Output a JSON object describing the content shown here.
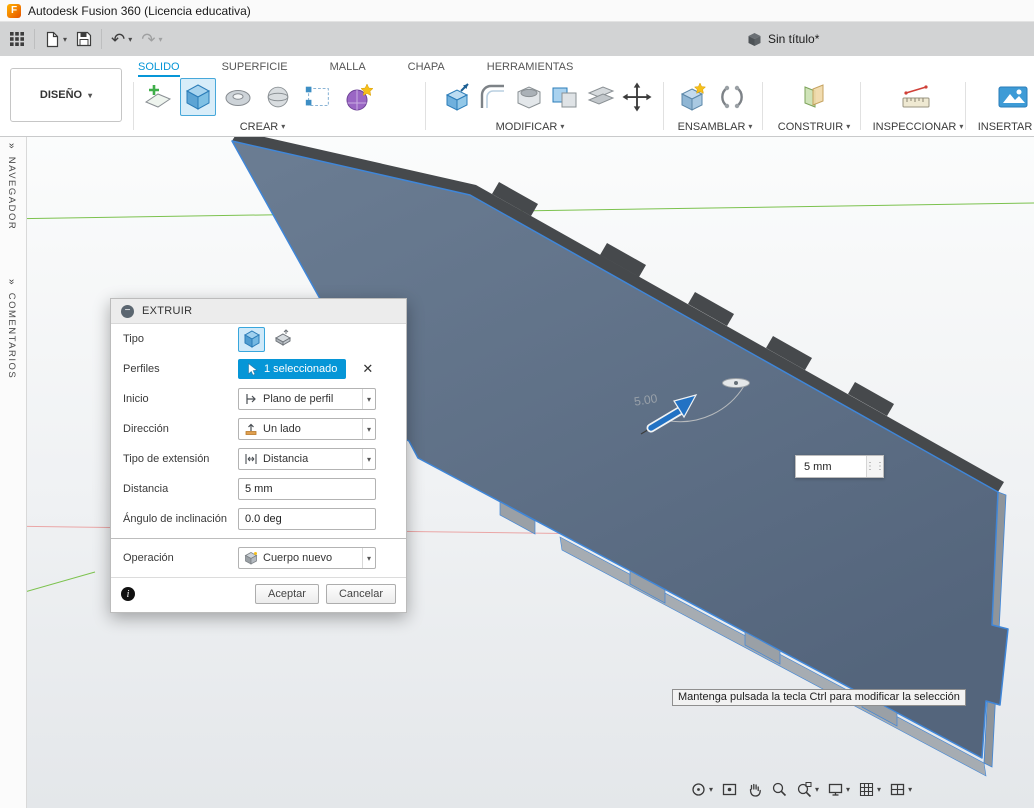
{
  "colors": {
    "accent_blue": "#0696d7",
    "selection_blue": "#3f86d8",
    "plate_face": "#5d7187",
    "axis_green": "#7cc24e",
    "axis_red": "#eaa6a6"
  },
  "icons": {
    "caret_down": "▾",
    "undo": "↶",
    "redo": "↷",
    "close": "✕",
    "info": "i",
    "expand_chevrons": "»",
    "grip_dots": "⋮⋮",
    "minus": "−"
  },
  "titlebar": {
    "app_title": "Autodesk Fusion 360 (Licencia educativa)",
    "logo_letter": "F"
  },
  "quickbar": {
    "document_title": "Sin título*"
  },
  "ribbon": {
    "workspace_button": "DISEÑO",
    "tabs": [
      {
        "label": "SOLIDO",
        "active": true
      },
      {
        "label": "SUPERFICIE",
        "active": false
      },
      {
        "label": "MALLA",
        "active": false
      },
      {
        "label": "CHAPA",
        "active": false
      },
      {
        "label": "HERRAMIENTAS",
        "active": false
      }
    ],
    "groups": [
      {
        "label": "CREAR"
      },
      {
        "label": "MODIFICAR"
      },
      {
        "label": "ENSAMBLAR"
      },
      {
        "label": "CONSTRUIR"
      },
      {
        "label": "INSPECCIONAR"
      },
      {
        "label": "INSERTAR"
      }
    ]
  },
  "side_panels": {
    "navigator_label": "NAVEGADOR",
    "comments_label": "COMENTARIOS"
  },
  "dialog": {
    "title": "EXTRUIR",
    "labels": {
      "tipo": "Tipo",
      "perfiles": "Perfiles",
      "inicio": "Inicio",
      "direccion": "Dirección",
      "tipo_extension": "Tipo de extensión",
      "distancia": "Distancia",
      "angulo": "Ángulo de inclinación",
      "operacion": "Operación"
    },
    "values": {
      "perfiles_chip": "1 seleccionado",
      "inicio": "Plano de perfil",
      "direccion": "Un lado",
      "tipo_extension": "Distancia",
      "distancia": "5 mm",
      "angulo": "0.0 deg",
      "operacion": "Cuerpo nuevo"
    },
    "buttons": {
      "accept": "Aceptar",
      "cancel": "Cancelar"
    }
  },
  "viewport": {
    "dimension_label": "5.00",
    "distance_input_value": "5 mm",
    "tooltip": "Mantenga pulsada la tecla Ctrl para modificar la selección"
  }
}
